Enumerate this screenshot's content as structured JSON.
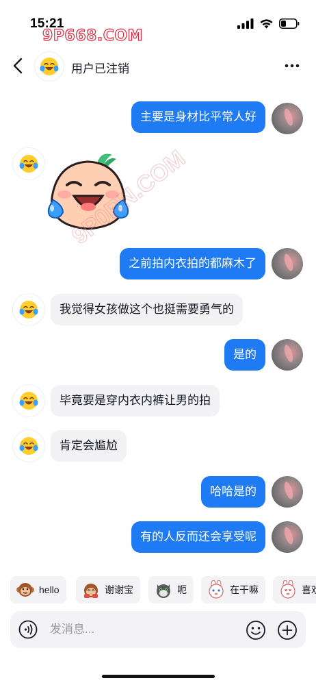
{
  "status_bar": {
    "time": "15:21",
    "watermark": "9P668.COM",
    "icons": [
      "signal-icon",
      "wifi-icon",
      "battery-icon"
    ]
  },
  "header": {
    "title": "用户已注销",
    "back_icon": "chevron-left-icon",
    "more_icon": "more-dots-icon"
  },
  "messages": [
    {
      "from": "self",
      "type": "text",
      "text": "主要是身材比平常人好"
    },
    {
      "from": "other",
      "type": "sticker",
      "sticker": "crying-laughing-peach-sticker"
    },
    {
      "from": "self",
      "type": "text",
      "text": "之前拍内衣拍的都麻木了"
    },
    {
      "from": "other",
      "type": "text",
      "text": "我觉得女孩做这个也挺需要勇气的"
    },
    {
      "from": "self",
      "type": "text",
      "text": "是的"
    },
    {
      "from": "other",
      "type": "text",
      "text": "毕竟要是穿内衣内裤让男的拍"
    },
    {
      "from": "other",
      "type": "text",
      "text": "肯定会尴尬"
    },
    {
      "from": "self",
      "type": "text",
      "text": "哈哈是的"
    },
    {
      "from": "self",
      "type": "text",
      "text": "有的人反而还会享受呢"
    }
  ],
  "quick_replies": [
    {
      "label": "hello",
      "icon": "monkey-emoji"
    },
    {
      "label": "谢谢宝",
      "icon": "monkey-bow-emoji"
    },
    {
      "label": "呃",
      "icon": "cat-emoji"
    },
    {
      "label": "在干嘛",
      "icon": "bunny-emoji"
    },
    {
      "label": "喜欢",
      "icon": "bunny-heart-emoji"
    }
  ],
  "input": {
    "placeholder": "发消息...",
    "value": ""
  },
  "colors": {
    "outgoing_bubble": "#1e7bf4",
    "incoming_bubble": "#f2f2f4",
    "watermark": "#e5243b"
  }
}
